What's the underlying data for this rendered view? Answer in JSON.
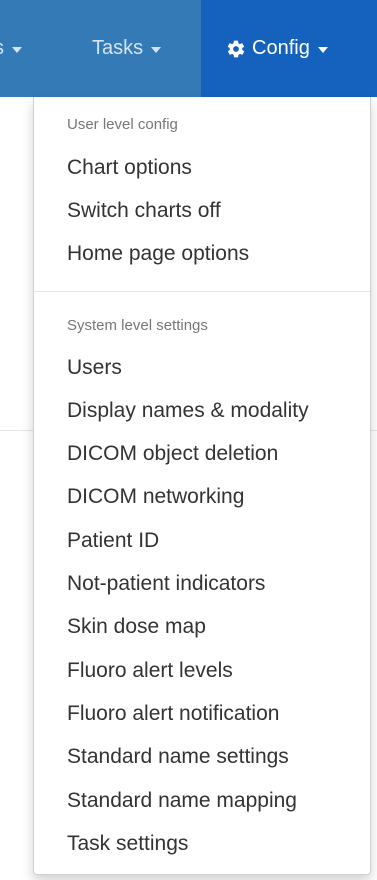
{
  "navbar": {
    "prev_item": {
      "label": "s"
    },
    "tasks": {
      "label": "Tasks"
    },
    "config": {
      "label": "Config",
      "icon": "gear-icon"
    },
    "colors": {
      "bar": "#337ab7",
      "active": "#1462bd",
      "text": "#ffffff",
      "muted_text": "#d4e3f1"
    }
  },
  "dropdown": {
    "user_header": "User level config",
    "user_items": [
      {
        "label": "Chart options"
      },
      {
        "label": "Switch charts off"
      },
      {
        "label": "Home page options"
      }
    ],
    "system_header": "System level settings",
    "system_items": [
      {
        "label": "Users"
      },
      {
        "label": "Display names & modality"
      },
      {
        "label": "DICOM object deletion"
      },
      {
        "label": "DICOM networking"
      },
      {
        "label": "Patient ID"
      },
      {
        "label": "Not-patient indicators"
      },
      {
        "label": "Skin dose map"
      },
      {
        "label": "Fluoro alert levels"
      },
      {
        "label": "Fluoro alert notification"
      },
      {
        "label": "Standard name settings"
      },
      {
        "label": "Standard name mapping"
      },
      {
        "label": "Task settings"
      }
    ]
  }
}
